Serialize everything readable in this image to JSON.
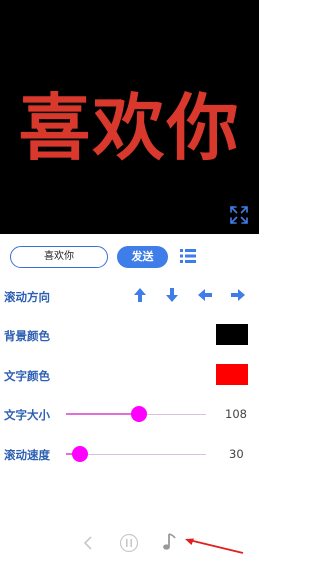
{
  "preview": {
    "text": "喜欢你",
    "text_color": "#d9382c",
    "background_color": "#000000"
  },
  "controls": {
    "input_value": "喜欢你",
    "send_label": "发送"
  },
  "settings": {
    "scroll_direction_label": "滚动方向",
    "background_color_label": "背景颜色",
    "background_color_value": "#000000",
    "text_color_label": "文字颜色",
    "text_color_value": "#ff0000",
    "text_size_label": "文字大小",
    "text_size_value": "108",
    "text_size_fraction": 0.52,
    "scroll_speed_label": "滚动速度",
    "scroll_speed_value": "30",
    "scroll_speed_fraction": 0.1
  },
  "icons": [
    "fullscreen-icon",
    "list-icon",
    "arrow-up-icon",
    "arrow-down-icon",
    "arrow-left-icon",
    "arrow-right-icon",
    "prev-icon",
    "pause-icon",
    "music-note-icon",
    "annotation-arrow"
  ],
  "accent_color": "#3f7ee8",
  "slider_color": "#ff00ff"
}
